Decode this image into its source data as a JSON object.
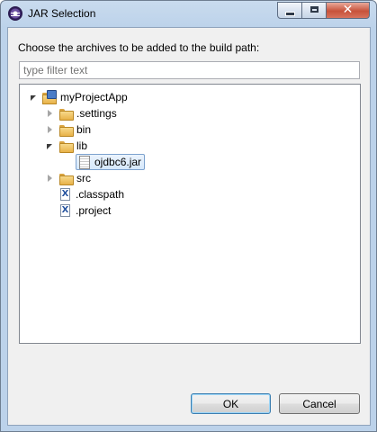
{
  "window": {
    "title": "JAR Selection",
    "icon": "eclipse-icon",
    "controls": {
      "minimize": "minimize-icon",
      "maximize": "maximize-icon",
      "close": "close-icon",
      "close_glyph": "✕"
    }
  },
  "dialog": {
    "prompt": "Choose the archives to be added to the build path:",
    "filter": {
      "value": "",
      "placeholder": "type filter text"
    }
  },
  "tree": {
    "project": {
      "label": "myProjectApp",
      "expanded": true,
      "icon": "java-project-icon"
    },
    "items": [
      {
        "label": ".settings",
        "icon": "folder-icon",
        "expandable": true,
        "expanded": false
      },
      {
        "label": "bin",
        "icon": "folder-icon",
        "expandable": true,
        "expanded": false
      },
      {
        "label": "lib",
        "icon": "folder-icon",
        "expandable": true,
        "expanded": true,
        "children": [
          {
            "label": "ojdbc6.jar",
            "icon": "jar-file-icon",
            "selected": true
          }
        ]
      },
      {
        "label": "src",
        "icon": "folder-icon",
        "expandable": true,
        "expanded": false
      },
      {
        "label": ".classpath",
        "icon": "xml-file-icon",
        "glyph": "X"
      },
      {
        "label": ".project",
        "icon": "xml-file-icon",
        "glyph": "X"
      }
    ]
  },
  "buttons": {
    "ok": "OK",
    "cancel": "Cancel"
  },
  "colors": {
    "title_bar": "#bcd2ea",
    "selection": "#d6e8fb",
    "folder": "#e8b248",
    "close_button": "#c7523a"
  }
}
